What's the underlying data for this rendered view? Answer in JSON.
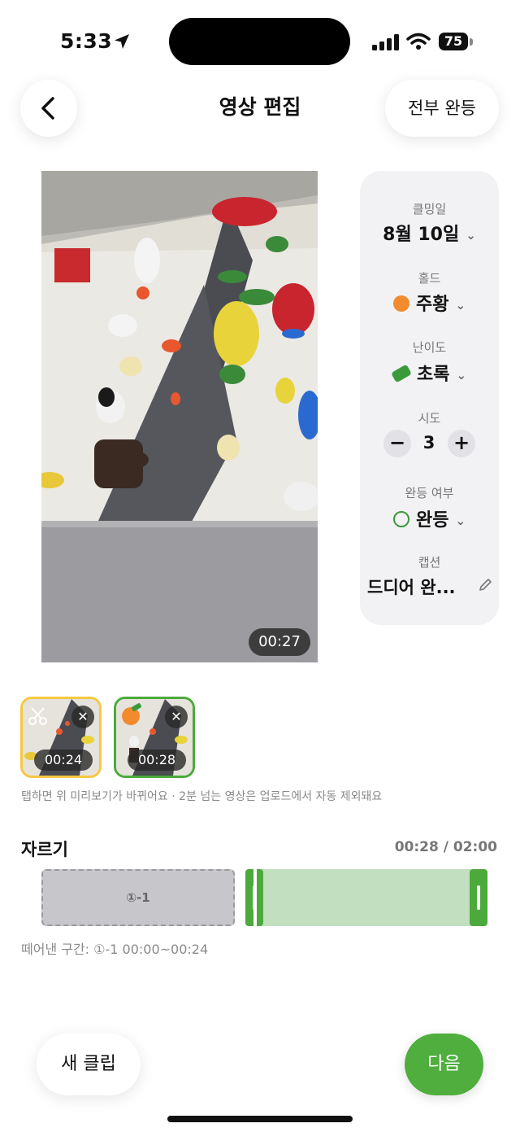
{
  "status": {
    "time": "5:33",
    "battery": "75"
  },
  "header": {
    "title": "영상 편집",
    "all_send_label": "전부 완등"
  },
  "video": {
    "duration": "00:27"
  },
  "panel": {
    "date": {
      "label": "클밍일",
      "value": "8월 10일"
    },
    "hold": {
      "label": "홀드",
      "value": "주황",
      "color": "#f28a2e"
    },
    "grade": {
      "label": "난이도",
      "value": "초록",
      "color": "#3a9a3a"
    },
    "attempts": {
      "label": "시도",
      "value": "3",
      "minus": "−",
      "plus": "+"
    },
    "status": {
      "label": "완등 여부",
      "value": "완등"
    },
    "caption": {
      "label": "캡션",
      "value": "드디어 완..."
    }
  },
  "thumbnails": [
    {
      "time": "00:24",
      "border": "#f5c842"
    },
    {
      "time": "00:28",
      "border": "#4caa3c"
    }
  ],
  "helper_text": "탭하면 위 미리보기가 바뀌어요 · 2분 넘는 영상은 업로드에서 자동 제외돼요",
  "trim": {
    "title": "자르기",
    "counter": "00:28 / 02:00",
    "cut_label": "①-1",
    "removed_info": "떼어낸 구간: ①-1 00:00~00:24"
  },
  "footer": {
    "new_clip_label": "새 클립",
    "next_label": "다음"
  },
  "colors": {
    "accent": "#4fae3d",
    "hold_orange": "#f28a2e",
    "grade_green": "#3a9a3a"
  }
}
